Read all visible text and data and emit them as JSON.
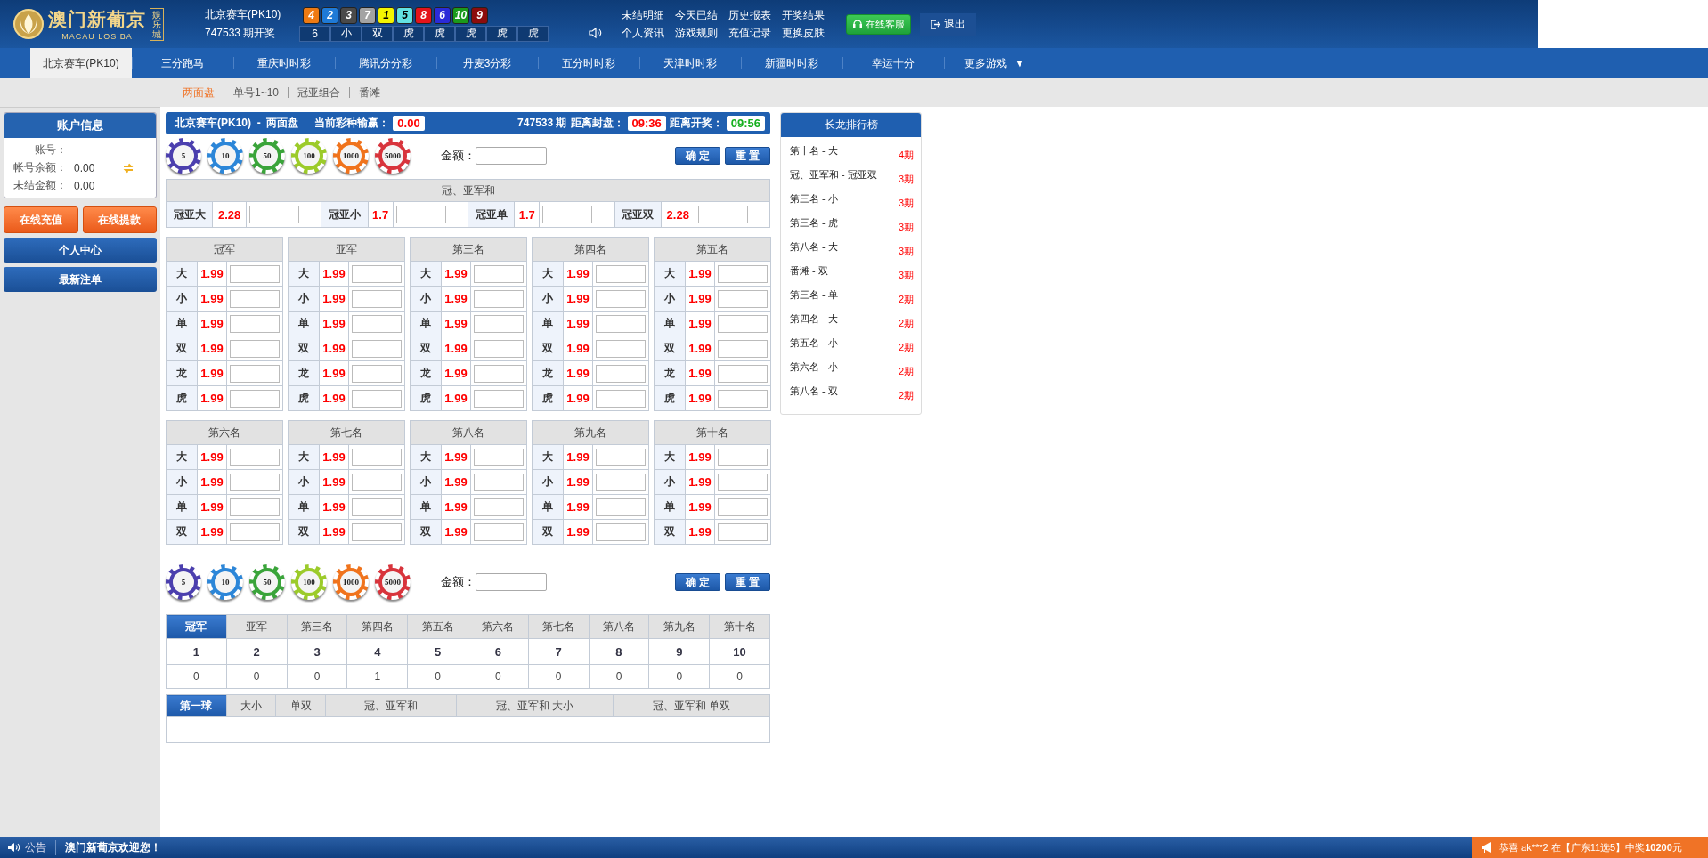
{
  "header": {
    "logo": {
      "title": "澳门新葡京",
      "subtitle": "MACAU LOSIBA",
      "badge": "娱乐城"
    },
    "game": "北京赛车(PK10)",
    "draw": "747533 期开奖",
    "balls": [
      {
        "number": "4",
        "color": "#ee7a12"
      },
      {
        "number": "2",
        "color": "#1f7ad6"
      },
      {
        "number": "3",
        "color": "#4a4a4a"
      },
      {
        "number": "7",
        "color": "#a3a3a3"
      },
      {
        "number": "1",
        "color": "#f4f400"
      },
      {
        "number": "5",
        "color": "#62e2e2"
      },
      {
        "number": "8",
        "color": "#e5141b"
      },
      {
        "number": "6",
        "color": "#2b2bd8"
      },
      {
        "number": "10",
        "color": "#1b9a1b"
      },
      {
        "number": "9",
        "color": "#8c0c0c"
      }
    ],
    "results": [
      "6",
      "小",
      "双",
      "虎",
      "虎",
      "虎",
      "虎",
      "虎"
    ],
    "links": [
      "未结明细",
      "今天已结",
      "历史报表",
      "开奖结果",
      "个人资讯",
      "游戏规则",
      "充值记录",
      "更换皮肤"
    ],
    "service_button": "在线客服",
    "logout_button": "退出"
  },
  "nav": {
    "tabs": [
      {
        "label": "北京赛车(PK10)",
        "selected": true
      },
      {
        "label": "三分跑马",
        "selected": false
      },
      {
        "label": "重庆时时彩",
        "selected": false
      },
      {
        "label": "腾讯分分彩",
        "selected": false
      },
      {
        "label": "丹麦3分彩",
        "selected": false
      },
      {
        "label": "五分时时彩",
        "selected": false
      },
      {
        "label": "天津时时彩",
        "selected": false
      },
      {
        "label": "新疆时时彩",
        "selected": false
      },
      {
        "label": "幸运十分",
        "selected": false
      },
      {
        "label": "更多游戏",
        "selected": false
      }
    ],
    "more_icon": "▼"
  },
  "subnav": [
    {
      "label": "两面盘",
      "selected": true
    },
    {
      "label": "单号1~10",
      "selected": false
    },
    {
      "label": "冠亚组合",
      "selected": false
    },
    {
      "label": "番滩",
      "selected": false
    }
  ],
  "sidebar": {
    "title": "账户信息",
    "fields": [
      {
        "label": "账号："
      },
      {
        "label": "帐号余额：",
        "value": "0.00",
        "refresh": true
      },
      {
        "label": "未结金额：",
        "value": "0.00",
        "refresh": false
      }
    ],
    "buttons": [
      {
        "label": "在线充值",
        "kind": "orange"
      },
      {
        "label": "在线提款",
        "kind": "orange"
      }
    ],
    "menu": [
      "个人中心",
      "最新注单"
    ]
  },
  "bet_panel": {
    "title": "北京赛车(PK10)  -  两面盘",
    "profit_label": "当前彩种输赢：",
    "profit": "0.00",
    "period": "747533 期",
    "close_label": "距离封盘：",
    "close_time": "09:36",
    "open_label": "距离开奖：",
    "open_time": "09:56",
    "controls_top": {
      "chips": [
        "5",
        "10",
        "50",
        "100",
        "1000",
        "5000"
      ],
      "amount_label": "金额：",
      "confirm_button": "确 定",
      "reset_button": "重 置"
    },
    "sum_section": {
      "title": "冠、亚军和",
      "options": [
        {
          "label": "冠亚大",
          "odds": "2.28"
        },
        {
          "label": "冠亚小",
          "odds": "1.7"
        },
        {
          "label": "冠亚单",
          "odds": "1.7"
        },
        {
          "label": "冠亚双",
          "odds": "2.28"
        }
      ]
    },
    "positions": [
      {
        "title": "冠军",
        "options": [
          {
            "label": "大",
            "odds": "1.99"
          },
          {
            "label": "小",
            "odds": "1.99"
          },
          {
            "label": "单",
            "odds": "1.99"
          },
          {
            "label": "双",
            "odds": "1.99"
          },
          {
            "label": "龙",
            "odds": "1.99"
          },
          {
            "label": "虎",
            "odds": "1.99"
          }
        ]
      },
      {
        "title": "亚军",
        "options": [
          {
            "label": "大",
            "odds": "1.99"
          },
          {
            "label": "小",
            "odds": "1.99"
          },
          {
            "label": "单",
            "odds": "1.99"
          },
          {
            "label": "双",
            "odds": "1.99"
          },
          {
            "label": "龙",
            "odds": "1.99"
          },
          {
            "label": "虎",
            "odds": "1.99"
          }
        ]
      },
      {
        "title": "第三名",
        "options": [
          {
            "label": "大",
            "odds": "1.99"
          },
          {
            "label": "小",
            "odds": "1.99"
          },
          {
            "label": "单",
            "odds": "1.99"
          },
          {
            "label": "双",
            "odds": "1.99"
          },
          {
            "label": "龙",
            "odds": "1.99"
          },
          {
            "label": "虎",
            "odds": "1.99"
          }
        ]
      },
      {
        "title": "第四名",
        "options": [
          {
            "label": "大",
            "odds": "1.99"
          },
          {
            "label": "小",
            "odds": "1.99"
          },
          {
            "label": "单",
            "odds": "1.99"
          },
          {
            "label": "双",
            "odds": "1.99"
          },
          {
            "label": "龙",
            "odds": "1.99"
          },
          {
            "label": "虎",
            "odds": "1.99"
          }
        ]
      },
      {
        "title": "第五名",
        "options": [
          {
            "label": "大",
            "odds": "1.99"
          },
          {
            "label": "小",
            "odds": "1.99"
          },
          {
            "label": "单",
            "odds": "1.99"
          },
          {
            "label": "双",
            "odds": "1.99"
          },
          {
            "label": "龙",
            "odds": "1.99"
          },
          {
            "label": "虎",
            "odds": "1.99"
          }
        ]
      },
      {
        "title": "第六名",
        "options": [
          {
            "label": "大",
            "odds": "1.99"
          },
          {
            "label": "小",
            "odds": "1.99"
          },
          {
            "label": "单",
            "odds": "1.99"
          },
          {
            "label": "双",
            "odds": "1.99"
          }
        ]
      },
      {
        "title": "第七名",
        "options": [
          {
            "label": "大",
            "odds": "1.99"
          },
          {
            "label": "小",
            "odds": "1.99"
          },
          {
            "label": "单",
            "odds": "1.99"
          },
          {
            "label": "双",
            "odds": "1.99"
          }
        ]
      },
      {
        "title": "第八名",
        "options": [
          {
            "label": "大",
            "odds": "1.99"
          },
          {
            "label": "小",
            "odds": "1.99"
          },
          {
            "label": "单",
            "odds": "1.99"
          },
          {
            "label": "双",
            "odds": "1.99"
          }
        ]
      },
      {
        "title": "第九名",
        "options": [
          {
            "label": "大",
            "odds": "1.99"
          },
          {
            "label": "小",
            "odds": "1.99"
          },
          {
            "label": "单",
            "odds": "1.99"
          },
          {
            "label": "双",
            "odds": "1.99"
          }
        ]
      },
      {
        "title": "第十名",
        "options": [
          {
            "label": "大",
            "odds": "1.99"
          },
          {
            "label": "小",
            "odds": "1.99"
          },
          {
            "label": "单",
            "odds": "1.99"
          },
          {
            "label": "双",
            "odds": "1.99"
          }
        ]
      }
    ],
    "controls_bottom": {
      "chips": [
        "5",
        "10",
        "50",
        "100",
        "1000",
        "5000"
      ],
      "amount_label": "金额：",
      "confirm_button": "确 定",
      "reset_button": "重 置"
    }
  },
  "stats": {
    "tabs": [
      {
        "label": "冠军",
        "selected": true
      },
      {
        "label": "亚军",
        "selected": false
      },
      {
        "label": "第三名",
        "selected": false
      },
      {
        "label": "第四名",
        "selected": false
      },
      {
        "label": "第五名",
        "selected": false
      },
      {
        "label": "第六名",
        "selected": false
      },
      {
        "label": "第七名",
        "selected": false
      },
      {
        "label": "第八名",
        "selected": false
      },
      {
        "label": "第九名",
        "selected": false
      },
      {
        "label": "第十名",
        "selected": false
      }
    ],
    "numbers": [
      "1",
      "2",
      "3",
      "4",
      "5",
      "6",
      "7",
      "8",
      "9",
      "10"
    ],
    "counts": [
      "0",
      "0",
      "0",
      "1",
      "0",
      "0",
      "0",
      "0",
      "0",
      "0"
    ]
  },
  "trend": {
    "tabs": [
      {
        "label": "第一球",
        "selected": true
      },
      {
        "label": "大小",
        "selected": false
      },
      {
        "label": "单双",
        "selected": false
      },
      {
        "label": "冠、亚军和",
        "selected": false
      },
      {
        "label": "冠、亚军和 大小",
        "selected": false
      },
      {
        "label": "冠、亚军和 单双",
        "selected": false
      }
    ]
  },
  "ranking": {
    "title": "长龙排行榜",
    "items": [
      {
        "name": "第十名 - 大",
        "streak": "4期"
      },
      {
        "name": "冠、亚军和 - 冠亚双",
        "streak": "3期"
      },
      {
        "name": "第三名 - 小",
        "streak": "3期"
      },
      {
        "name": "第三名 - 虎",
        "streak": "3期"
      },
      {
        "name": "第八名 - 大",
        "streak": "3期"
      },
      {
        "name": "番滩 - 双",
        "streak": "3期"
      },
      {
        "name": "第三名 - 单",
        "streak": "2期"
      },
      {
        "name": "第四名 - 大",
        "streak": "2期"
      },
      {
        "name": "第五名 - 小",
        "streak": "2期"
      },
      {
        "name": "第六名 - 小",
        "streak": "2期"
      },
      {
        "name": "第八名 - 双",
        "streak": "2期"
      }
    ]
  },
  "status_bar": {
    "notice_label": "公告",
    "message": "澳门新葡京欢迎您！",
    "winner": {
      "prefix": "恭喜 ak***2 在【广东11选5】中奖",
      "prize": "10200",
      "suffix": "元"
    }
  }
}
